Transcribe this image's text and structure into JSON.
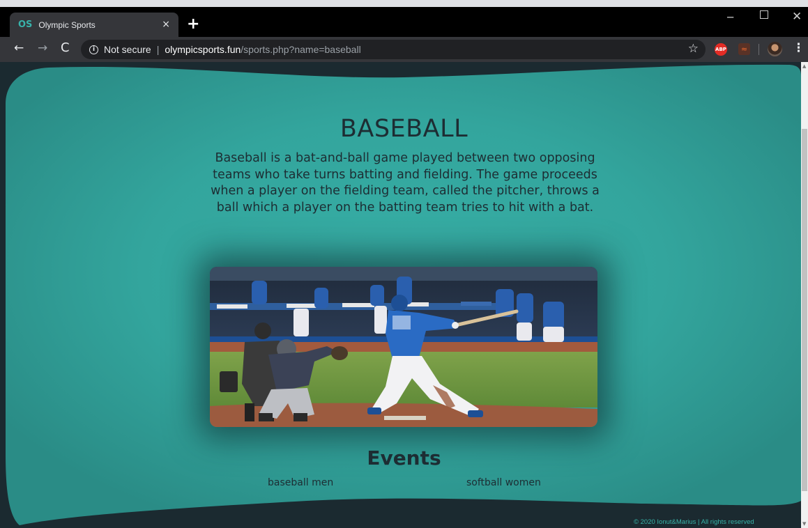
{
  "browser": {
    "tab": {
      "favicon": "OS",
      "title": "Olympic Sports",
      "close": "×"
    },
    "new_tab": "+",
    "window_controls": {
      "minimize": "─",
      "maximize": "",
      "close": "✕"
    },
    "nav": {
      "back": "←",
      "forward": "→",
      "reload": "C"
    },
    "address": {
      "security_icon": "ⓘ",
      "security_text": "Not secure",
      "separator": "|",
      "host": "olympicsports.fun",
      "path": "/sports.php?name=baseball"
    },
    "bookmark_icon": "☆",
    "extension_abp_label": "ABP",
    "extension_2_glyph": "≈",
    "menu_icon": "⋮"
  },
  "page": {
    "title": "BASEBALL",
    "description": "Baseball is a bat-and-ball game played between two opposing teams who take turns batting and fielding. The game proceeds when a player on the fielding team, called the pitcher, throws a ball which a player on the batting team tries to hit with a bat.",
    "events_title": "Events",
    "events": [
      "baseball men",
      "softball women"
    ],
    "footer": "© 2020 Ionut&Marius | All rights reserved"
  },
  "colors": {
    "teal": "#37b3a8",
    "dark": "#1b2a30",
    "text": "#1d2d33"
  }
}
